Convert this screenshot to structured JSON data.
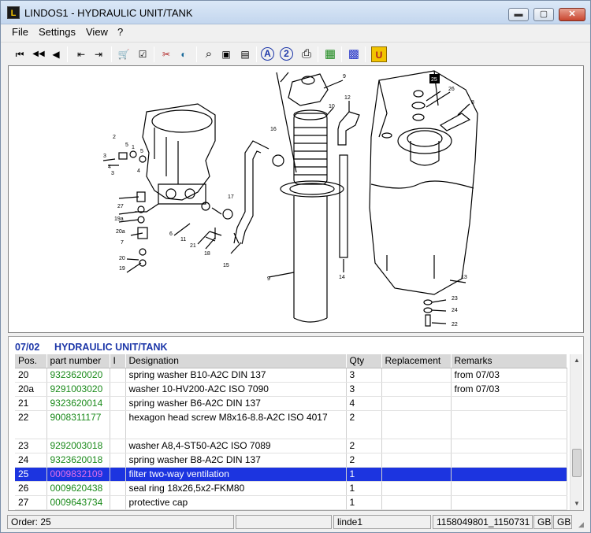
{
  "window": {
    "title": "LINDOS1 - HYDRAULIC UNIT/TANK",
    "app_icon_text": "L",
    "min_symbol": "▬",
    "max_symbol": "▢",
    "close_symbol": "✕"
  },
  "menu": {
    "file": "File",
    "settings": "Settings",
    "view": "View",
    "help": "?"
  },
  "toolbar": {
    "buttons": [
      {
        "icon": "first-icon",
        "glyph": "⏮"
      },
      {
        "icon": "back-fast-icon",
        "glyph": "◀◀"
      },
      {
        "icon": "back-icon",
        "glyph": "◀"
      },
      {
        "icon": "export-icon",
        "glyph": "⇤"
      },
      {
        "icon": "import-icon",
        "glyph": "⇥"
      },
      {
        "icon": "cart-icon",
        "glyph": "🛒"
      },
      {
        "icon": "clipboard-icon",
        "glyph": "☑"
      },
      {
        "icon": "tools-icon",
        "glyph": "✂"
      },
      {
        "icon": "globe-icon",
        "glyph": "◐"
      },
      {
        "icon": "zoom-icon",
        "glyph": "⌕"
      },
      {
        "icon": "page-icon",
        "glyph": "▣"
      },
      {
        "icon": "page-corner-icon",
        "glyph": "▤"
      },
      {
        "icon": "search-a-icon",
        "glyph": "A"
      },
      {
        "icon": "search-2-icon",
        "glyph": "2"
      },
      {
        "icon": "print-icon",
        "glyph": "⎙"
      },
      {
        "icon": "book-icon",
        "glyph": "▦"
      },
      {
        "icon": "grid-icon",
        "glyph": "▩"
      },
      {
        "icon": "u-icon",
        "glyph": "U"
      }
    ]
  },
  "drawing": {
    "callouts": [
      "9",
      "10",
      "12",
      "25",
      "26",
      "8",
      "2",
      "3",
      "1",
      "5",
      "4",
      "3",
      "4",
      "16",
      "27",
      "19a",
      "20a",
      "7",
      "20",
      "19",
      "6",
      "11",
      "17",
      "21",
      "18",
      "15",
      "9",
      "14",
      "13",
      "23",
      "24",
      "22"
    ],
    "highlighted_callout": "25"
  },
  "parts": {
    "section_number": "07/02",
    "section_title": "HYDRAULIC UNIT/TANK",
    "columns": [
      "Pos.",
      "part number",
      "I",
      "Designation",
      "Qty",
      "Replacement",
      "Remarks"
    ],
    "rows": [
      {
        "pos": "20",
        "part": "9323620020",
        "i": "",
        "designation": "spring washer B10-A2C  DIN 137",
        "qty": "3",
        "replacement": "",
        "remarks": "from 07/03"
      },
      {
        "pos": "20a",
        "part": "9291003020",
        "i": "",
        "designation": "washer 10-HV200-A2C  ISO 7090",
        "qty": "3",
        "replacement": "",
        "remarks": "from 07/03"
      },
      {
        "pos": "21",
        "part": "9323620014",
        "i": "",
        "designation": "spring washer B6-A2C  DIN 137",
        "qty": "4",
        "replacement": "",
        "remarks": ""
      },
      {
        "pos": "22",
        "part": "9008311177",
        "i": "",
        "designation": "hexagon head screw M8x16-8.8-A2C  ISO 4017",
        "qty": "2",
        "replacement": "",
        "remarks": ""
      },
      {
        "pos": "23",
        "part": "9292003018",
        "i": "",
        "designation": "washer A8,4-ST50-A2C  ISO 7089",
        "qty": "2",
        "replacement": "",
        "remarks": ""
      },
      {
        "pos": "24",
        "part": "9323620018",
        "i": "",
        "designation": "spring washer B8-A2C  DIN 137",
        "qty": "2",
        "replacement": "",
        "remarks": ""
      },
      {
        "pos": "25",
        "part": "0009832109",
        "i": "",
        "designation": "filter two-way ventilation",
        "qty": "1",
        "replacement": "",
        "remarks": ""
      },
      {
        "pos": "26",
        "part": "0009620438",
        "i": "",
        "designation": "seal ring 18x26,5x2-FKM80",
        "qty": "1",
        "replacement": "",
        "remarks": ""
      },
      {
        "pos": "27",
        "part": "0009643734",
        "i": "",
        "designation": "protective cap",
        "qty": "1",
        "replacement": "",
        "remarks": ""
      }
    ],
    "selected_pos": "25"
  },
  "status": {
    "order": "Order: 25",
    "field2": "",
    "user": "linde1",
    "codes": "1158049801_1150731",
    "lang1": "GB",
    "lang2": "GB"
  },
  "colors": {
    "selection": "#1c34e0",
    "part_number": "#1b8a1b",
    "selected_part_number": "#e26fe8",
    "section_title": "#1c36a8"
  }
}
